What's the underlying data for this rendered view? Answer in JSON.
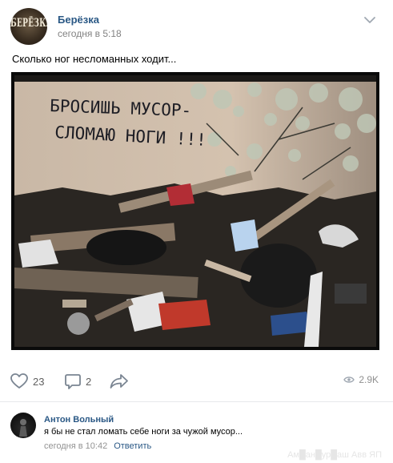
{
  "post": {
    "author": "Берёзка",
    "avatar_label": "БЕРЁЗКА",
    "time": "сегодня в 5:18",
    "text": "Сколько ног несломанных ходит...",
    "menu_icon": "chevron-down-icon",
    "photo": {
      "graffiti_line1": "БРОСИШЬ МУСОР-",
      "graffiti_line2": "СЛОМАЮ НОГИ !!!"
    }
  },
  "actions": {
    "likes": "23",
    "comments": "2",
    "views": "2.9K",
    "icons": [
      "heart-icon",
      "comment-icon",
      "share-icon",
      "eye-icon"
    ]
  },
  "comment": {
    "author": "Антон Вольный",
    "text": "я бы не стал ломать себе ноги за чужой мусор...",
    "time": "сегодня в 10:42",
    "reply_label": "Ответить"
  },
  "watermark": "Ам█ан█ур█аш Авв ЯП",
  "colors": {
    "link": "#2a5885",
    "muted": "#828282",
    "divider": "#e7e8ec"
  }
}
